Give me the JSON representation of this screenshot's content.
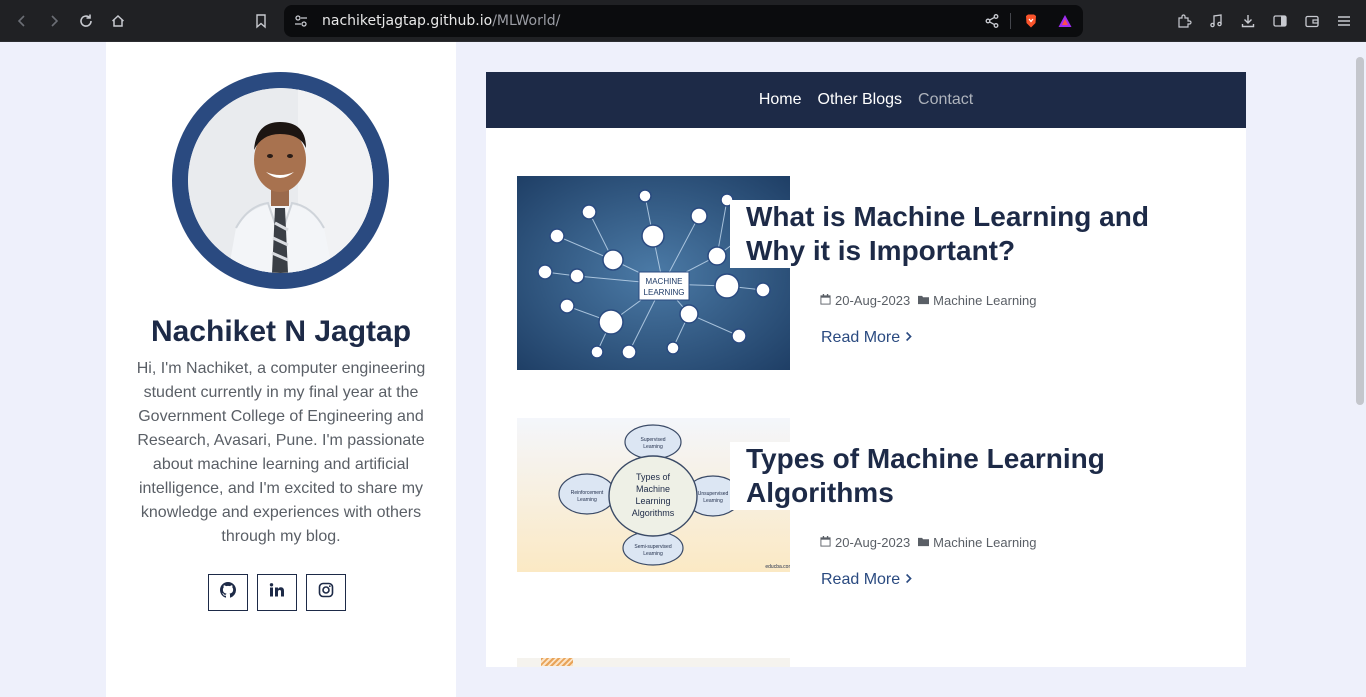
{
  "browser": {
    "url_host": "nachiketjagtap.github.io",
    "url_path": "/MLWorld/"
  },
  "sidebar": {
    "name": "Nachiket N Jagtap",
    "bio": "Hi, I'm Nachiket, a computer engineering student currently in my final year at the Government College of Engineering and Research, Avasari, Pune. I'm passionate about machine learning and artificial intelligence, and I'm excited to share my knowledge and experiences with others through my blog.",
    "socials": [
      "github-icon",
      "linkedin-icon",
      "instagram-icon"
    ]
  },
  "nav": {
    "items": [
      "Home",
      "Other Blogs",
      "Contact"
    ]
  },
  "posts": [
    {
      "title": "What is Machine Learning and Why it is Important?",
      "date": "20-Aug-2023",
      "category": "Machine Learning",
      "read_more": "Read More",
      "image_label": "MACHINE LEARNING"
    },
    {
      "title": "Types of Machine Learning Algorithms",
      "date": "20-Aug-2023",
      "category": "Machine Learning",
      "read_more": "Read More",
      "image_center": "Types of Machine Learning Algorithms",
      "image_nodes": [
        "Supervised Learning",
        "Unsupervised Learning",
        "Semi-supervised Learning",
        "Reinforcement Learning"
      ],
      "image_credit": "educba.com"
    }
  ],
  "colors": {
    "navy": "#1d2a47",
    "accent": "#2a4a80",
    "page_bg": "#eef0fb"
  }
}
